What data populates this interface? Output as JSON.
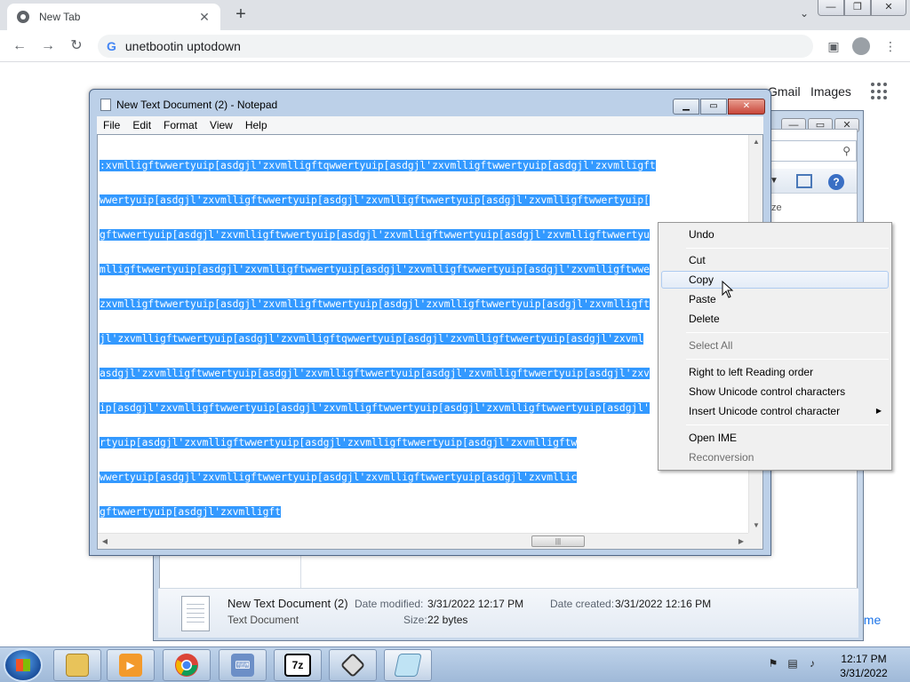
{
  "browser": {
    "tab_title": "New Tab",
    "tab_close_glyph": "✕",
    "new_tab_glyph": "+",
    "omnibox_text": "unetbootin uptodown",
    "page_links": {
      "gmail": "Gmail",
      "images": "Images",
      "home_partial": "ome"
    }
  },
  "notepad": {
    "title": "New Text Document (2) - Notepad",
    "menu": [
      "File",
      "Edit",
      "Format",
      "View",
      "Help"
    ],
    "lines": [
      ":xvmlligftwwertyuip[asdgjl'zxvmlligftqwwertyuip[asdgjl'zxvmlligftwwertyuip[asdgjl'zxvmlligft",
      "wwertyuip[asdgjl'zxvmlligftwwertyuip[asdgjl'zxvmlligftwwertyuip[asdgjl'zxvmlligftwwertyuip[",
      "gftwwertyuip[asdgjl'zxvmlligftwwertyuip[asdgjl'zxvmlligftwwertyuip[asdgjl'zxvmlligftwwertyu",
      "mlligftwwertyuip[asdgjl'zxvmlligftwwertyuip[asdgjl'zxvmlligftwwertyuip[asdgjl'zxvmlligftwwe",
      "zxvmlligftwwertyuip[asdgjl'zxvmlligftwwertyuip[asdgjl'zxvmlligftwwertyuip[asdgjl'zxvmlligft",
      "jl'zxvmlligftwwertyuip[asdgjl'zxvmlligftqwwertyuip[asdgjl'zxvmlligftwwertyuip[asdgjl'zxvml",
      "asdgjl'zxvmlligftwwertyuip[asdgjl'zxvmlligftwwertyuip[asdgjl'zxvmlligftwwertyuip[asdgjl'zxv",
      "ip[asdgjl'zxvmlligftwwertyuip[asdgjl'zxvmlligftwwertyuip[asdgjl'zxvmlligftwwertyuip[asdgjl'",
      "rtyuip[asdgjl'zxvmlligftwwertyuip[asdgjl'zxvmlligftwwertyuip[asdgjl'zxvmlligftw",
      "wwertyuip[asdgjl'zxvmlligftwwertyuip[asdgjl'zxvmlligftwwertyuip[asdgjl'zxvmllic",
      "gftwwertyuip[asdgjl'zxvmlligft"
    ]
  },
  "context_menu": {
    "items": [
      {
        "label": "Undo",
        "enabled": true
      },
      {
        "label": "Cut",
        "enabled": true
      },
      {
        "label": "Copy",
        "enabled": true,
        "highlighted": true
      },
      {
        "label": "Paste",
        "enabled": true
      },
      {
        "label": "Delete",
        "enabled": true
      },
      {
        "label": "Select All",
        "enabled": false
      },
      {
        "label": "Right to left Reading order",
        "enabled": true
      },
      {
        "label": "Show Unicode control characters",
        "enabled": true
      },
      {
        "label": "Insert Unicode control character",
        "enabled": true,
        "submenu": true
      },
      {
        "label": "Open IME",
        "enabled": true
      },
      {
        "label": "Reconversion",
        "enabled": false
      }
    ]
  },
  "explorer": {
    "column_partial": "ze",
    "details": {
      "file_name": "New Text Document (2)",
      "file_type": "Text Document",
      "date_modified_label": "Date modified:",
      "date_modified": "3/31/2022 12:17 PM",
      "date_created_label": "Date created:",
      "date_created": "3/31/2022 12:16 PM",
      "size_label": "Size:",
      "size": "22 bytes"
    }
  },
  "taskbar": {
    "apps": [
      "file-explorer",
      "media-player",
      "chrome",
      "network",
      "7zip",
      "tool",
      "notepad"
    ],
    "seven_zip_label": "7z",
    "clock_time": "12:17 PM",
    "clock_date": "3/31/2022"
  },
  "colors": {
    "selection": "#3399ff",
    "chrome_tabbar": "#dee1e6",
    "taskbar": "#a9c3e0"
  }
}
